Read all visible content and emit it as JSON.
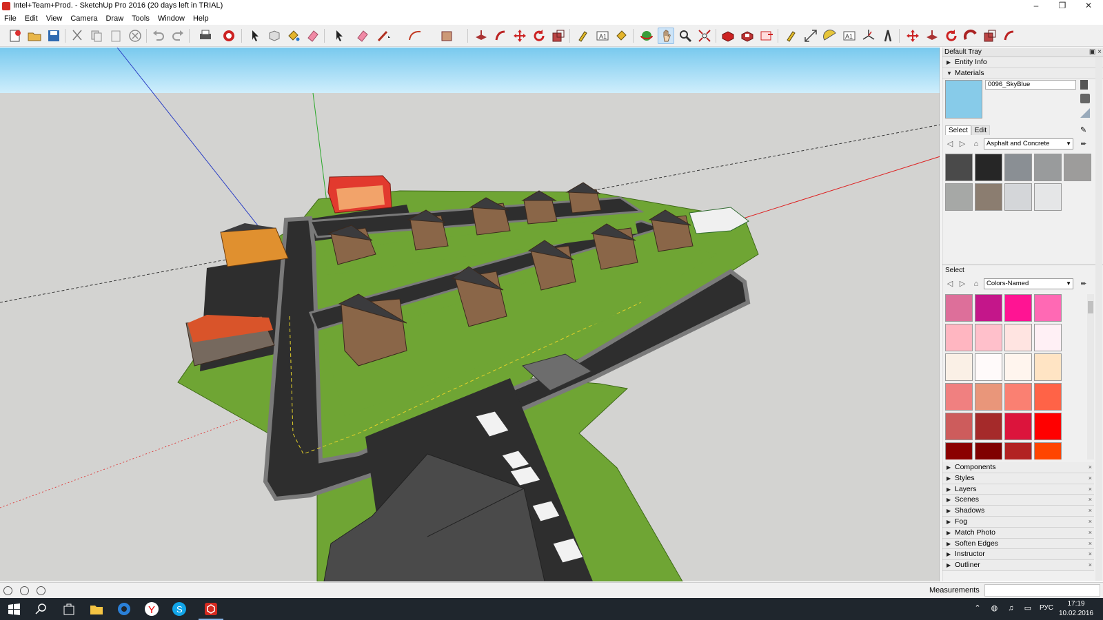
{
  "window": {
    "title": "Intel+Team+Prod. - SketchUp Pro 2016 (20 days left in TRIAL)",
    "controls": {
      "minimize": "–",
      "restore": "❐",
      "close": "✕"
    }
  },
  "menu": [
    "File",
    "Edit",
    "View",
    "Camera",
    "Draw",
    "Tools",
    "Window",
    "Help"
  ],
  "toolbar": {
    "active_tool": "pan-tool",
    "tools": [
      "new",
      "open",
      "save",
      "cut",
      "copy",
      "paste",
      "erase",
      "undo",
      "redo",
      "print",
      "model-info",
      "select",
      "make-component",
      "paint-bucket",
      "eraser",
      "select",
      "eraser",
      "line",
      "arc",
      "rectangle",
      "push-pull",
      "follow-me",
      "move",
      "rotate",
      "scale",
      "tape-measure",
      "text",
      "paint",
      "orbit",
      "pan",
      "zoom",
      "zoom-extents",
      "warehouse",
      "extension-warehouse",
      "layout",
      "tape",
      "dimension",
      "protractor",
      "text-3d",
      "axes",
      "3d-text",
      "move",
      "push-pull",
      "rotate",
      "offset",
      "scale",
      "follow-me"
    ]
  },
  "tray": {
    "title": "Default Tray",
    "header_buttons": "▣ ×",
    "sections_top": [
      {
        "label": "Entity Info",
        "expanded": false
      },
      {
        "label": "Materials",
        "expanded": true
      }
    ],
    "materials": {
      "current_name": "0096_SkyBlue",
      "current_color": "#87cbe9",
      "tab_select": "Select",
      "tab_edit": "Edit",
      "collection": "Asphalt and Concrete",
      "swatches": [
        "#4a4a4a",
        "#262626",
        "#8a8f94",
        "#999b9c",
        "#9d9c9b",
        "#a6a8a6",
        "#8b7d70",
        "#d4d6d9",
        "#e5e6e7"
      ],
      "secondary_label": "Select",
      "secondary_collection": "Colors-Named",
      "color_swatches": [
        "#dd6f9a",
        "#c4168a",
        "#ff1493",
        "#ff69b4",
        "#ffb6c1",
        "#ffc0cb",
        "#ffe4e1",
        "#fff0f5",
        "#faf0e6",
        "#fffafa",
        "#fff5ee",
        "#ffe4c4",
        "#f08080",
        "#e9967a",
        "#fa8072",
        "#ff6347",
        "#cd5c5c",
        "#a52a2a",
        "#dc143c",
        "#ff0000",
        "#8b0000",
        "#800000",
        "#b22222",
        "#ff4500"
      ]
    },
    "sections_bottom": [
      "Components",
      "Styles",
      "Layers",
      "Scenes",
      "Shadows",
      "Fog",
      "Match Photo",
      "Soften Edges",
      "Instructor",
      "Outliner"
    ]
  },
  "status": {
    "measurements_label": "Measurements",
    "measurements_value": ""
  },
  "taskbar": {
    "language": "РУС",
    "time": "17:19",
    "date": "10.02.2016",
    "tray_icons": "⌃ ◍ ♫ ▭"
  },
  "scene": {
    "sky_color": "#7fd0f0",
    "ground_color": "#d3d3d1",
    "grass_color": "#6fa534",
    "road_color": "#2e2e2e",
    "sidewalk_color": "#8a8a8a",
    "house_wall_color": "#8a6648",
    "roof_color": "#3b3b3d",
    "sign_color": "#e23a2e"
  }
}
